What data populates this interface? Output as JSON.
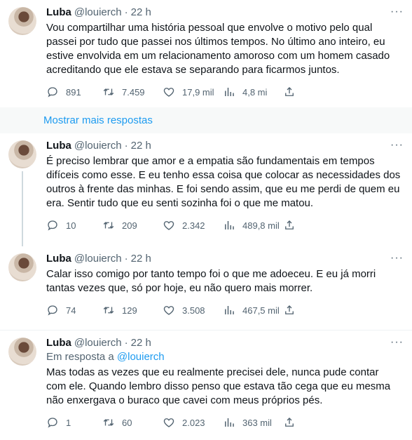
{
  "show_more_label": "Mostrar mais respostas",
  "tweets": [
    {
      "name": "Luba",
      "handle": "@louierch",
      "dot": "·",
      "time": "22 h",
      "reply_prefix": "",
      "reply_handle": "",
      "text": "Vou compartilhar uma história pessoal que envolve o motivo pelo qual\npassei por tudo que passei nos últimos tempos. No último ano inteiro, eu\nestive envolvida em um relacionamento amoroso com um homem casado\nacreditando que ele estava se separando para ficarmos juntos.",
      "replies": "891",
      "retweets": "7.459",
      "likes": "17,9 mil",
      "views": "4,8 mi"
    },
    {
      "name": "Luba",
      "handle": "@louierch",
      "dot": "·",
      "time": "22 h",
      "reply_prefix": "",
      "reply_handle": "",
      "text": "É preciso lembrar que amor e a empatia são fundamentais em tempos\ndifíceis como esse. E eu tenho essa coisa que colocar as necessidades dos\noutros à frente das minhas. E foi sendo assim, que eu me perdi de quem eu\nera. Sentir tudo que eu senti sozinha foi o que me matou.",
      "replies": "10",
      "retweets": "209",
      "likes": "2.342",
      "views": "489,8 mil"
    },
    {
      "name": "Luba",
      "handle": "@louierch",
      "dot": "·",
      "time": "22 h",
      "reply_prefix": "",
      "reply_handle": "",
      "text": "Calar isso comigo por tanto tempo foi o que me adoeceu. E eu já morri\ntantas vezes que, só por hoje, eu não quero mais morrer.",
      "replies": "74",
      "retweets": "129",
      "likes": "3.508",
      "views": "467,5 mil"
    },
    {
      "name": "Luba",
      "handle": "@louierch",
      "dot": "·",
      "time": "22 h",
      "reply_prefix": "Em resposta a ",
      "reply_handle": "@louierch",
      "text": "Mas todas as vezes que eu realmente precisei dele, nunca pude contar\ncom ele. Quando lembro disso penso que estava tão cega que eu mesma\nnão enxergava o buraco que cavei com meus próprios pés.",
      "replies": "1",
      "retweets": "60",
      "likes": "2.023",
      "views": "363 mil"
    }
  ],
  "icons": {
    "reply": "reply-icon",
    "retweet": "retweet-icon",
    "like": "heart-icon",
    "views": "views-icon",
    "share": "share-icon",
    "more": "more-icon"
  }
}
